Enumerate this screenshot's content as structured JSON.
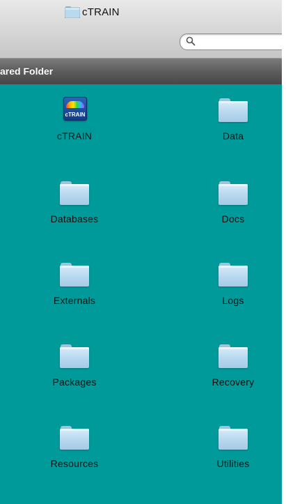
{
  "window": {
    "title": "cTRAIN",
    "search": {
      "value": "",
      "placeholder": ""
    },
    "pathbar_label": "ared Folder"
  },
  "items": [
    {
      "label": "cTRAIN",
      "type": "app",
      "app_icon_text": "cTRAIN"
    },
    {
      "label": "Data",
      "type": "folder"
    },
    {
      "label": "Databases",
      "type": "folder"
    },
    {
      "label": "Docs",
      "type": "folder"
    },
    {
      "label": "Externals",
      "type": "folder"
    },
    {
      "label": "Logs",
      "type": "folder"
    },
    {
      "label": "Packages",
      "type": "folder"
    },
    {
      "label": "Recovery",
      "type": "folder"
    },
    {
      "label": "Resources",
      "type": "folder"
    },
    {
      "label": "Utilities",
      "type": "folder"
    }
  ],
  "colors": {
    "content_background": "#009a9a",
    "pathbar_background": "#5c5c5c",
    "folder_blue": "#b6d7ee"
  }
}
